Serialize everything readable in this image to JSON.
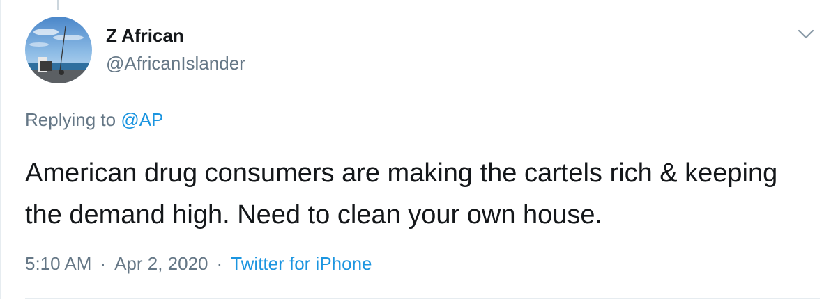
{
  "author": {
    "display_name": "Z African",
    "handle": "@AfricanIslander",
    "avatar_icon": "avatar-photo-fishing-by-sea"
  },
  "reply": {
    "prefix": "Replying to",
    "mention": "@AP"
  },
  "tweet": {
    "text": "American drug consumers are making the cartels rich & keeping the demand high. Need to clean your own house."
  },
  "meta": {
    "time": "5:10 AM",
    "separator": "·",
    "date": "Apr 2, 2020",
    "source": "Twitter for iPhone"
  },
  "colors": {
    "text_primary": "#14171a",
    "text_secondary": "#657786",
    "link": "#1b95e0",
    "divider": "#e6ecf0"
  },
  "icons": {
    "menu": "chevron-down-icon"
  }
}
